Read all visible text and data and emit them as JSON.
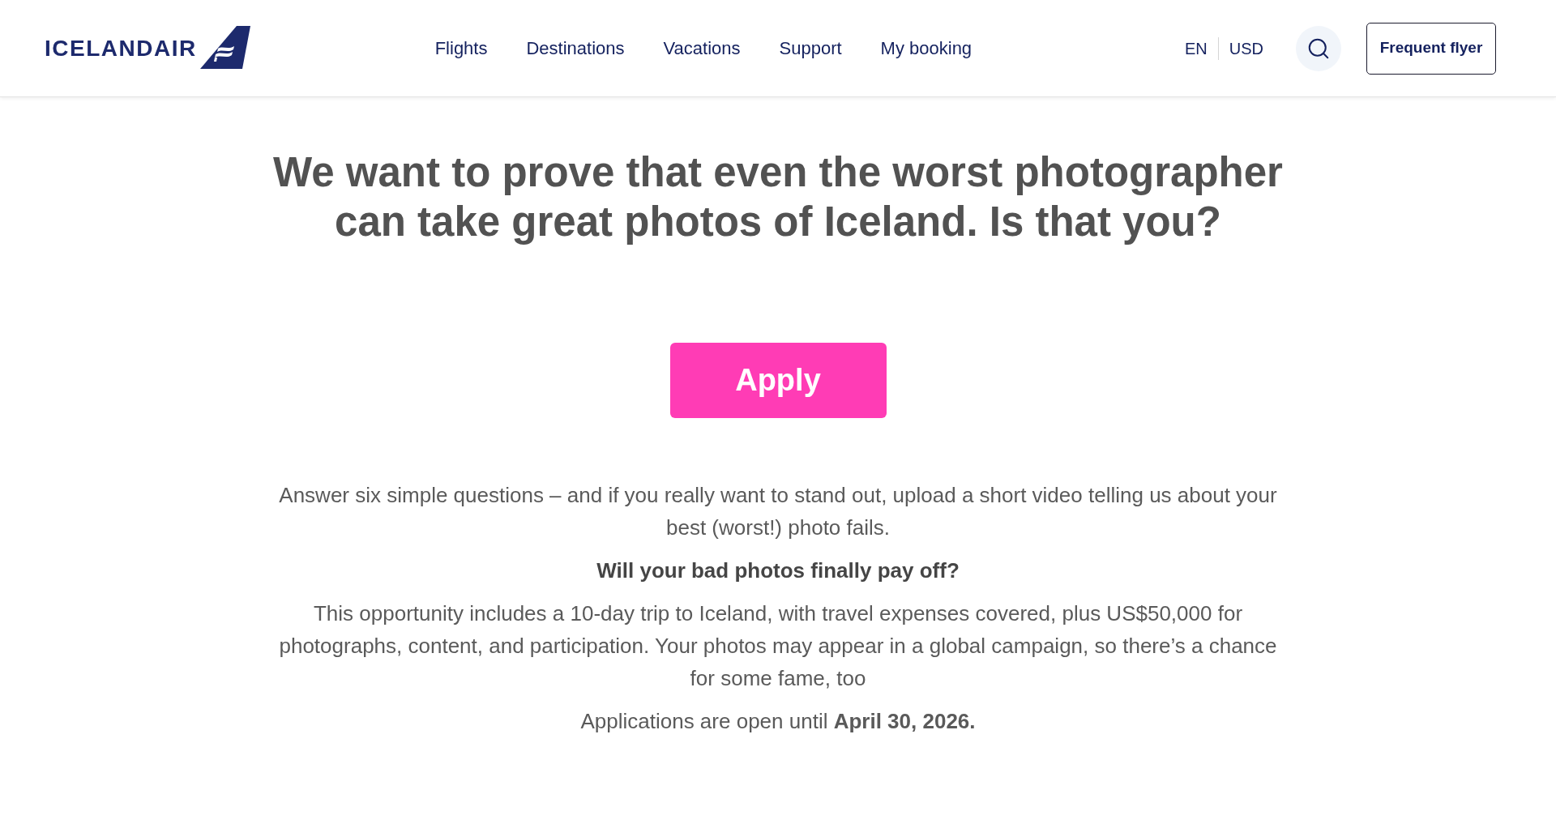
{
  "header": {
    "logo": {
      "text": "ICELANDAIR"
    },
    "nav": [
      "Flights",
      "Destinations",
      "Vacations",
      "Support",
      "My booking"
    ],
    "language": "EN",
    "currency": "USD",
    "frequent_flyer_button": "Frequent flyer"
  },
  "hero": {
    "heading": "We want to prove that even the worst photographer can take great photos of Iceland. Is that you?",
    "apply_button": "Apply"
  },
  "content": [
    {
      "kind": "paragraph",
      "text": "Answer six simple questions – and if you really want to stand out, upload a short video telling us about your best (worst!) photo fails."
    },
    {
      "kind": "subheading",
      "text": "Will your bad photos finally pay off?"
    },
    {
      "kind": "paragraph",
      "text": "This opportunity includes a 10-day trip to Iceland, with travel expenses covered, plus US$50,000 for photographs, content, and participation. Your photos may appear in a global campaign, so there’s a chance for some fame, too"
    },
    {
      "kind": "paragraph",
      "text": "Applications are open until **April 30, 2026.**"
    }
  ]
}
